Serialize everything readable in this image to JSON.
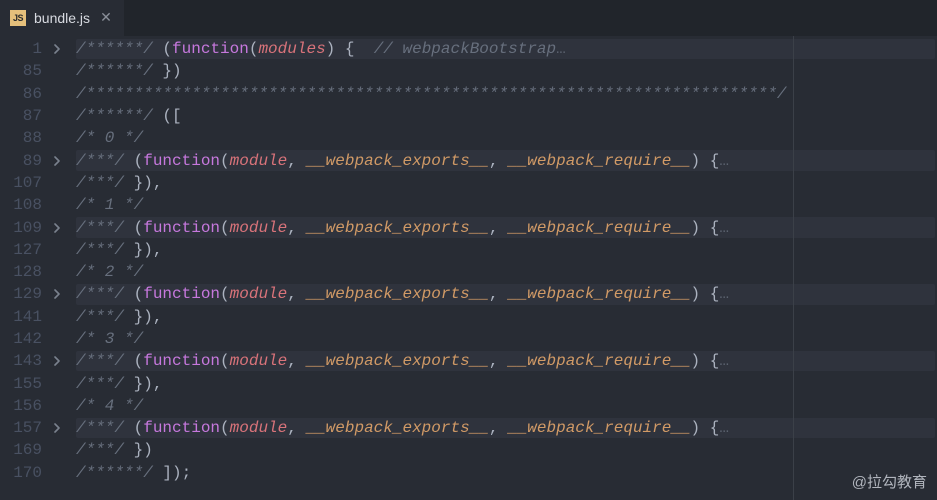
{
  "tab": {
    "icon_label": "JS",
    "filename": "bundle.js"
  },
  "watermark": "@拉勾教育",
  "lines": [
    {
      "n": 1,
      "fold": true,
      "folded_bg": true,
      "tokens": [
        [
          "c-comment",
          "/******/ "
        ],
        [
          "c-punc",
          "("
        ],
        [
          "c-keyword",
          "function"
        ],
        [
          "c-punc",
          "("
        ],
        [
          "c-param",
          "modules"
        ],
        [
          "c-punc",
          ") {  "
        ],
        [
          "c-comment",
          "// webpackBootstrap"
        ],
        [
          "ellipsis",
          "…"
        ]
      ]
    },
    {
      "n": 85,
      "fold": false,
      "tokens": [
        [
          "c-comment",
          "/******/ "
        ],
        [
          "c-punc",
          "})"
        ]
      ]
    },
    {
      "n": 86,
      "fold": false,
      "tokens": [
        [
          "c-comment",
          "/************************************************************************/"
        ]
      ]
    },
    {
      "n": 87,
      "fold": false,
      "tokens": [
        [
          "c-comment",
          "/******/ "
        ],
        [
          "c-punc",
          "(["
        ]
      ]
    },
    {
      "n": 88,
      "fold": false,
      "tokens": [
        [
          "c-comment",
          "/* 0 */"
        ]
      ]
    },
    {
      "n": 89,
      "fold": true,
      "folded_bg": true,
      "tokens": [
        [
          "c-comment",
          "/***/ "
        ],
        [
          "c-punc",
          "("
        ],
        [
          "c-keyword",
          "function"
        ],
        [
          "c-punc",
          "("
        ],
        [
          "c-param",
          "module"
        ],
        [
          "c-punc",
          ", "
        ],
        [
          "c-param-u",
          "__webpack_exports__"
        ],
        [
          "c-punc",
          ", "
        ],
        [
          "c-param-u",
          "__webpack_require__"
        ],
        [
          "c-punc",
          ") {"
        ],
        [
          "ellipsis",
          "…"
        ]
      ]
    },
    {
      "n": 107,
      "fold": false,
      "tokens": [
        [
          "c-comment",
          "/***/ "
        ],
        [
          "c-punc",
          "}),"
        ]
      ]
    },
    {
      "n": 108,
      "fold": false,
      "tokens": [
        [
          "c-comment",
          "/* 1 */"
        ]
      ]
    },
    {
      "n": 109,
      "fold": true,
      "folded_bg": true,
      "tokens": [
        [
          "c-comment",
          "/***/ "
        ],
        [
          "c-punc",
          "("
        ],
        [
          "c-keyword",
          "function"
        ],
        [
          "c-punc",
          "("
        ],
        [
          "c-param",
          "module"
        ],
        [
          "c-punc",
          ", "
        ],
        [
          "c-param-u",
          "__webpack_exports__"
        ],
        [
          "c-punc",
          ", "
        ],
        [
          "c-param-u",
          "__webpack_require__"
        ],
        [
          "c-punc",
          ") {"
        ],
        [
          "ellipsis",
          "…"
        ]
      ]
    },
    {
      "n": 127,
      "fold": false,
      "tokens": [
        [
          "c-comment",
          "/***/ "
        ],
        [
          "c-punc",
          "}),"
        ]
      ]
    },
    {
      "n": 128,
      "fold": false,
      "tokens": [
        [
          "c-comment",
          "/* 2 */"
        ]
      ]
    },
    {
      "n": 129,
      "fold": true,
      "folded_bg": true,
      "tokens": [
        [
          "c-comment",
          "/***/ "
        ],
        [
          "c-punc",
          "("
        ],
        [
          "c-keyword",
          "function"
        ],
        [
          "c-punc",
          "("
        ],
        [
          "c-param",
          "module"
        ],
        [
          "c-punc",
          ", "
        ],
        [
          "c-param-u",
          "__webpack_exports__"
        ],
        [
          "c-punc",
          ", "
        ],
        [
          "c-param-u",
          "__webpack_require__"
        ],
        [
          "c-punc",
          ") {"
        ],
        [
          "ellipsis",
          "…"
        ]
      ]
    },
    {
      "n": 141,
      "fold": false,
      "tokens": [
        [
          "c-comment",
          "/***/ "
        ],
        [
          "c-punc",
          "}),"
        ]
      ]
    },
    {
      "n": 142,
      "fold": false,
      "tokens": [
        [
          "c-comment",
          "/* 3 */"
        ]
      ]
    },
    {
      "n": 143,
      "fold": true,
      "folded_bg": true,
      "tokens": [
        [
          "c-comment",
          "/***/ "
        ],
        [
          "c-punc",
          "("
        ],
        [
          "c-keyword",
          "function"
        ],
        [
          "c-punc",
          "("
        ],
        [
          "c-param",
          "module"
        ],
        [
          "c-punc",
          ", "
        ],
        [
          "c-param-u",
          "__webpack_exports__"
        ],
        [
          "c-punc",
          ", "
        ],
        [
          "c-param-u",
          "__webpack_require__"
        ],
        [
          "c-punc",
          ") {"
        ],
        [
          "ellipsis",
          "…"
        ]
      ]
    },
    {
      "n": 155,
      "fold": false,
      "tokens": [
        [
          "c-comment",
          "/***/ "
        ],
        [
          "c-punc",
          "}),"
        ]
      ]
    },
    {
      "n": 156,
      "fold": false,
      "tokens": [
        [
          "c-comment",
          "/* 4 */"
        ]
      ]
    },
    {
      "n": 157,
      "fold": true,
      "folded_bg": true,
      "tokens": [
        [
          "c-comment",
          "/***/ "
        ],
        [
          "c-punc",
          "("
        ],
        [
          "c-keyword",
          "function"
        ],
        [
          "c-punc",
          "("
        ],
        [
          "c-param",
          "module"
        ],
        [
          "c-punc",
          ", "
        ],
        [
          "c-param-u",
          "__webpack_exports__"
        ],
        [
          "c-punc",
          ", "
        ],
        [
          "c-param-u",
          "__webpack_require__"
        ],
        [
          "c-punc",
          ") {"
        ],
        [
          "ellipsis",
          "…"
        ]
      ]
    },
    {
      "n": 169,
      "fold": false,
      "tokens": [
        [
          "c-comment",
          "/***/ "
        ],
        [
          "c-punc",
          "})"
        ]
      ]
    },
    {
      "n": 170,
      "fold": false,
      "tokens": [
        [
          "c-comment",
          "/******/ "
        ],
        [
          "c-punc",
          "]);"
        ]
      ]
    }
  ]
}
